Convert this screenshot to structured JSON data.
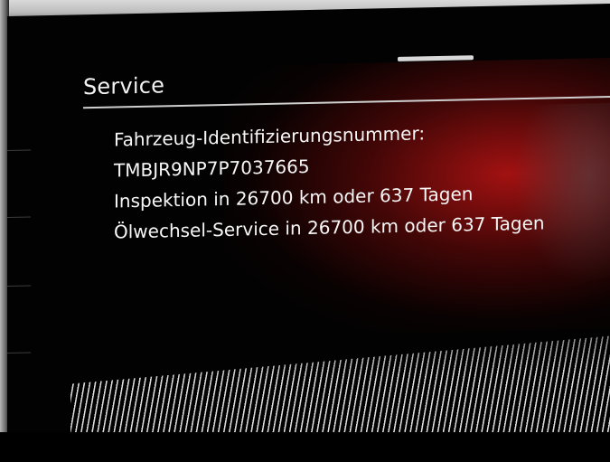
{
  "screen": {
    "title": "Service",
    "info_lines": [
      "Fahrzeug-Identifizierungsnummer:",
      "TMBJR9NP7P7037665",
      "Inspektion in 26700 km oder 637 Tagen",
      "Ölwechsel-Service in 26700 km oder 637 Tagen"
    ]
  },
  "colors": {
    "text": "#f2f2f2",
    "background": "#020202",
    "glare": "#b01414"
  }
}
